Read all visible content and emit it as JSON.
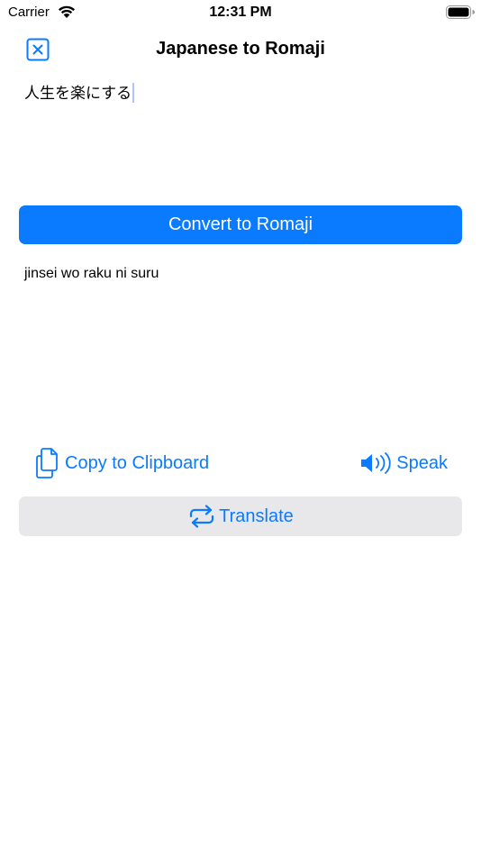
{
  "status_bar": {
    "carrier": "Carrier",
    "time": "12:31 PM"
  },
  "nav": {
    "title": "Japanese to Romaji",
    "close_icon": "close-square-icon"
  },
  "input": {
    "value": "人生を楽にする"
  },
  "convert_button": {
    "label": "Convert to Romaji"
  },
  "output": {
    "value": "jinsei wo raku ni suru"
  },
  "actions": {
    "copy_label": "Copy to Clipboard",
    "copy_icon": "documents-icon",
    "speak_label": "Speak",
    "speak_icon": "speaker-wave-icon"
  },
  "translate_button": {
    "label": "Translate",
    "icon": "repeat-arrows-icon"
  },
  "colors": {
    "accent": "#0a7bff",
    "secondary_button_bg": "#e8e8ea"
  }
}
